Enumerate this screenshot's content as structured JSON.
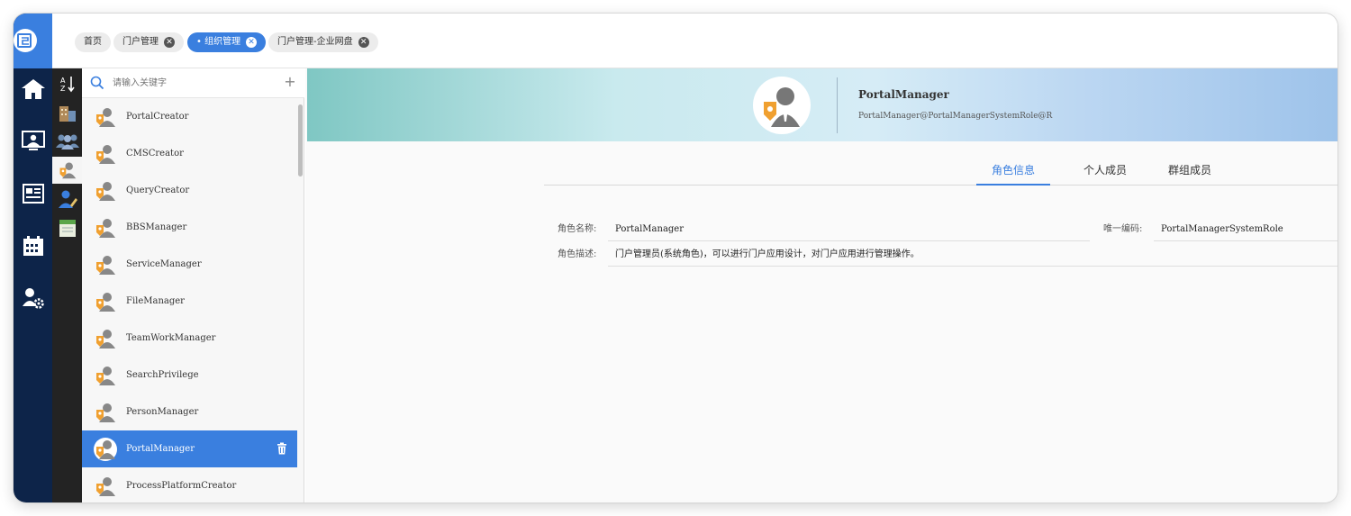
{
  "tabs": [
    {
      "label": "首页",
      "closable": false,
      "active": false
    },
    {
      "label": "门户管理",
      "closable": true,
      "active": false
    },
    {
      "label": "组织管理",
      "closable": true,
      "active": true
    },
    {
      "label": "门户管理-企业网盘",
      "closable": true,
      "active": false
    }
  ],
  "rail": {
    "icons": [
      "logo-icon",
      "home-icon",
      "monitor-user-icon",
      "news-icon",
      "calendar-icon",
      "user-settings-icon"
    ]
  },
  "subrail": {
    "icons": [
      "sort-az-icon",
      "building-icon",
      "group-icon",
      "role-icon",
      "user-edit-icon",
      "calendar-note-icon"
    ],
    "active_index": 3
  },
  "search": {
    "placeholder": "请输入关键字",
    "value": ""
  },
  "roles": [
    {
      "name": "PortalCreator"
    },
    {
      "name": "CMSCreator"
    },
    {
      "name": "QueryCreator"
    },
    {
      "name": "BBSManager"
    },
    {
      "name": "ServiceManager"
    },
    {
      "name": "FileManager"
    },
    {
      "name": "TeamWorkManager"
    },
    {
      "name": "SearchPrivilege"
    },
    {
      "name": "PersonManager"
    },
    {
      "name": "PortalManager",
      "active": true
    },
    {
      "name": "ProcessPlatformCreator"
    }
  ],
  "detail": {
    "name": "PortalManager",
    "dn": "PortalManager@PortalManagerSystemRole@R",
    "tabs": [
      "角色信息",
      "个人成员",
      "群组成员"
    ],
    "active_tab": 0,
    "fields": {
      "name_label": "角色名称:",
      "name_value": "PortalManager",
      "code_label": "唯一编码:",
      "code_value": "PortalManagerSystemRole",
      "desc_label": "角色描述:",
      "desc_value": "门户管理员(系统角色)，可以进行门户应用设计，对门户应用进行管理操作。"
    }
  },
  "colors": {
    "accent": "#3a7fdf",
    "rail": "#0d2449",
    "subrail": "#232323",
    "role_badge": "#f0a030"
  }
}
